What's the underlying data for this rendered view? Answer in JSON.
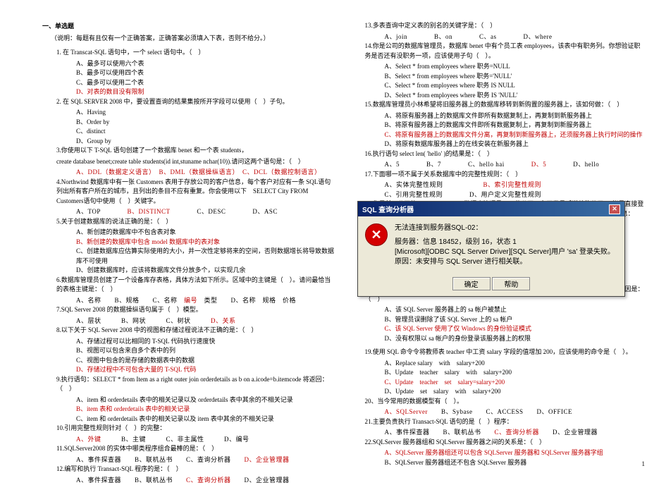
{
  "left": {
    "title": "一、单选题",
    "note": "（说明：每题有且仅有一个正确答案，正确答案必须填入下表，否则不给分。）",
    "q1": "1. 在 Transcat-SQL 语句中，一个 select 语句中。（　）",
    "q1a": "A、最多可以使用六个表",
    "q1b": "B、最多可以使用四个表",
    "q1c": "C、最多可以使用二个表",
    "q1d": "D、对表的数目没有限制",
    "q2": "2. 在 SQL SERVER 2008 中，要设置查询的结果集按所开字段可以使用（　）子句。",
    "q2a": "A、Having",
    "q2b": "B、Order by",
    "q2c": "C、distinct",
    "q2d": "D、Group by",
    "q3": "3.你使用以下 T-SQL 语句创建了一个数据库 benet 和一个表 students，",
    "q3b": "create database benet;create table students(id int,stuname nchar(10)).请问这两个语句是：（　）",
    "q3opt": "A、DDL（数据定义语言）　B、DML（数据操纵语言）　C、DCL（数据控制语言）",
    "q4": "4.Northwind 数据库中有一张 Customers 表用于存放公司的客户信息，每个客户对应有一条 SQL语句列出所有客户所在的城市，且列出的条目不应有重复。你会使用以下　SELECT City FROM Customers语句中使用（　）关键字。",
    "q4opt": "A、TOP　　　　B、DISTINCT　　　　C、DESC　　　　D、ASC",
    "q5": "5.关于创建数据库的说法正确的是：（　）",
    "q5a": "A、新创建的数据库中不包含表对象",
    "q5b": "B、新创建的数据库中包含 model 数据库中的表对象",
    "q5c": "C、创建数据库应估算实际使用的大小，并一次性定够将来的空间，否则数据增长将导致数据库不可使用",
    "q5d": "D、创建数据库时，应该将数据库文件分放多个，以实现几余",
    "q6": "6.数据库管理员创建了一个设备库存表格，具体方法如下所示。区域中的主键是（　）。请问最恰当的表格主键是：（　）",
    "q6r1": "A、名称　　B、规格　　C、名称　规格　　D、名称　规格　价格",
    "q6ex": "编号　类型",
    "q7": "7.SQL Server 2008 的数据操纵语句属于（　）模型。",
    "q7opt": "A、层状　　　B、网状　　　C、树状　　　D、关系",
    "q8": "8.以下关于 SQL Server 2008 中的视图和存储过程说法不正确的是：（　）",
    "q8a": "A、存储过程可以比相同的 T-SQL 代码执行速度快",
    "q8b": "B、视图可以包含来自多个表中的列",
    "q8c": "C、视图中包含的是存储的数据表中的数据",
    "q8d": "D、存储过程中不可包含大量的 T-SQL 代码",
    "q9": "9.执行语句：SELECT * from Item as a right outer join orderdetails as b on a.icode=b.itemcode 将返回：（　）",
    "q9a": "A、item 和 orderdetails 表中的相关记录以及 orderdetails 表中其余的不相关记录",
    "q9b": "B、item 表和 orderdetails 表中的相关记录",
    "q9c": "C、item 和 orderdetails 表中的相关记录以及 item 表中其余的不相关记录",
    "q10": "10.引用完整性规则针对（　）的完整：",
    "q10opt": "A、外键　　　B、主键　　　C、非主属性　　　D、编号",
    "q11": "11.SQLServer2008 的实体中哪类程序组合最棒的是：（　）",
    "q11opt": "A、事件探查器　　B、联机丛书　　C、查询分析器　　D、企业管理器",
    "q12": "12.编写和执行 Transact-SQL 程序的是：（　）",
    "q12opt": "A、事件探查器　　B、联机丛书　　C、查询分析器　　D、企业管理器"
  },
  "right": {
    "q13": "13.多表查询中定义表的别名的关键字是：（　）",
    "q13opt": "A、join　　　　B、on　　　　C、as　　　　D、where",
    "q14": "14.你是公司的数据库管理员，数据库 benet 中有个员工表 employees，该表中有职务列。你想验证职务是否还有没职务一项，应该使用子句（　）。",
    "q14a": "A、Select * from employees where 职务=NULL",
    "q14b": "B、Select * from employees where 职务='NULL'",
    "q14c": "C、Select * from employees where 职务 IS NULL",
    "q14d": "D、Select * from employees where 职务 IS 'NULL'",
    "q15": "15.数据库管理员小林希望将旧服务器上的数据库移转到新购置的服务器上，该如何做：（　）",
    "q15a": "A、将原有服务器上的数据库文件即所有数据复制上，再复制到新服务器上",
    "q15b": "B、将原有服务器上的数据库文件即所有数据复制上，再复制到新服务器上",
    "q15c": "C、将原有服务器上的数据库文件分离，再复制到新服务器上，还须服务器上执行时间的操作",
    "q15d": "D、将原有数据库服务器上的在线安装在新服务器上",
    "q16": "16.执行语句 select len( 'hello' )的结果是：（　）",
    "q16opt": "A、5　　　　B、7　　　　C、hello hai　　　　D、5　　　　D、hello",
    "q17": "17.下面哪一项不属于关系数据库中的完整性规则：（　）",
    "q17opt": "A、实体完整性规则　　　　B、索引完整性规则",
    "q17opt2": "C、引用完整性规则　　　　D、用户定义完整性规则",
    "q18": "18.你是某IT公司的 SQL Server 2008 数据库管理员。一位公司一名开发员听说他能使用 sa 帐号直接登陆公司用于测试的 SQL Server 2008 数据库服务器上，随即进行测试时弹出了如下图所示的信息：",
    "q18b": "但是当他使用自己的域用户帐号时却可以直接到该服务器上；那么产生这种错误最有可能的原因是：（　）",
    "q18a2": "A、该 SQL Server 服务器上的 sa 帐户被禁止",
    "q18b2": "B、管理员误删除了该 SQL Server 上的 sa 帐户",
    "q18c2": "C、该 SQL Server 使用了仅 Windows 的身份验证模式",
    "q18d2": "D、没有权限以 sa 帐户的身份登录该服务器上的权限",
    "q19": "19.使用 SQL 命令令将教师表 teacher 中工资 salary 字段的值增加 200，应该使用的命令是（　）。",
    "q19a": "A、Replace salary　with　salary+200",
    "q19b": "B、Update　teacher　salary　with　salary+200",
    "q19c": "C、Update　teacher　set　salary=salary+200",
    "q19d": "D、Update　set　salary　with　salary+200",
    "q20": "20、当今常用的数据模型有（　）。",
    "q20opt": "A、SQLServer　　B、Sybase　　C、ACCESS　　D、OFFICE",
    "q21": "21.主要负责执行 Transact-SQL 语句的是（　）程序：",
    "q21opt": "A、事件探查器　　B、联机丛书　　C、查询分析器　　D、企业管理器",
    "q22": "22.SQLServer 服务器组和 SQLServer 服务器之间的关系是：（　）",
    "q22a": "A、SQLServer 服务器组还可以包含 SQLServer 服务器和 SQLServer 服务器字组",
    "q22b": "B、SQLServer 服务器组还不包含 SQLServer 服务器"
  },
  "dialog": {
    "title": "SQL 查询分析器",
    "line1": "无法连接到服务器SQL-02：",
    "line2": "服务器：信息 18452，级别 16，状态 1",
    "line3": "[Microsoft][ODBC SQL Server Driver][SQL Server]用户 'sa' 登录失败。原因：未安排与 SQL Server 进行相关联。",
    "ok": "确定",
    "help": "帮助"
  },
  "page": "1"
}
